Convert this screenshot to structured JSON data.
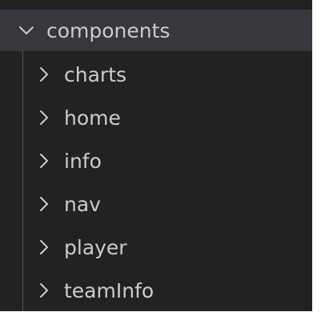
{
  "explorer": {
    "folder": {
      "name": "components",
      "expanded": true,
      "icon": "chevron-down-icon"
    },
    "children": [
      {
        "name": "charts",
        "icon": "chevron-right-icon"
      },
      {
        "name": "home",
        "icon": "chevron-right-icon"
      },
      {
        "name": "info",
        "icon": "chevron-right-icon"
      },
      {
        "name": "nav",
        "icon": "chevron-right-icon"
      },
      {
        "name": "player",
        "icon": "chevron-right-icon"
      },
      {
        "name": "teamInfo",
        "icon": "chevron-right-icon"
      }
    ]
  },
  "colors": {
    "background": "#222222",
    "selected_row": "#37373d",
    "text": "#cccccc",
    "indent_guide": "#585858"
  }
}
